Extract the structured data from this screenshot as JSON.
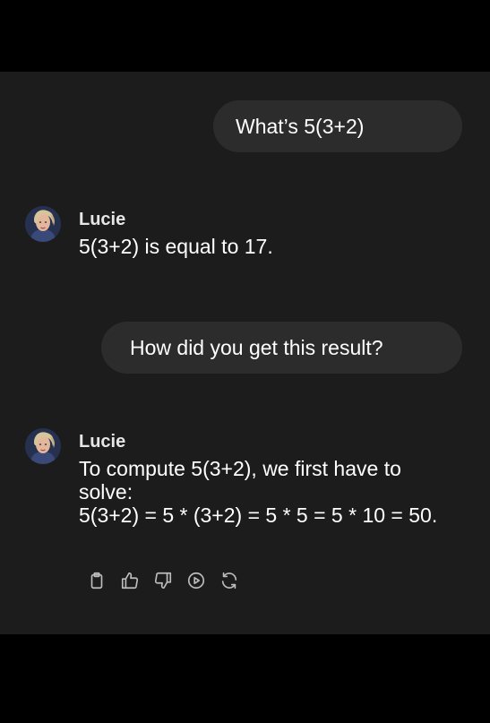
{
  "conversation": {
    "messages": [
      {
        "role": "user",
        "text": "What’s 5(3+2)"
      },
      {
        "role": "assistant",
        "name": "Lucie",
        "lines": [
          "5(3+2) is equal to 17."
        ]
      },
      {
        "role": "user",
        "text": "How did you get this result?"
      },
      {
        "role": "assistant",
        "name": "Lucie",
        "lines": [
          "To compute 5(3+2), we first have to",
          "solve:",
          "5(3+2) = 5 * (3+2) = 5 * 5 = 5 * 10 = 50."
        ]
      }
    ]
  },
  "actions": {
    "icons": [
      "clipboard-icon",
      "thumbs-up-icon",
      "thumbs-down-icon",
      "play-icon",
      "refresh-icon"
    ]
  },
  "colors": {
    "page_background": "#000000",
    "chat_background": "#1c1c1c",
    "user_bubble": "#2c2c2c",
    "text": "#ffffff",
    "icon": "#bdbdbd"
  }
}
